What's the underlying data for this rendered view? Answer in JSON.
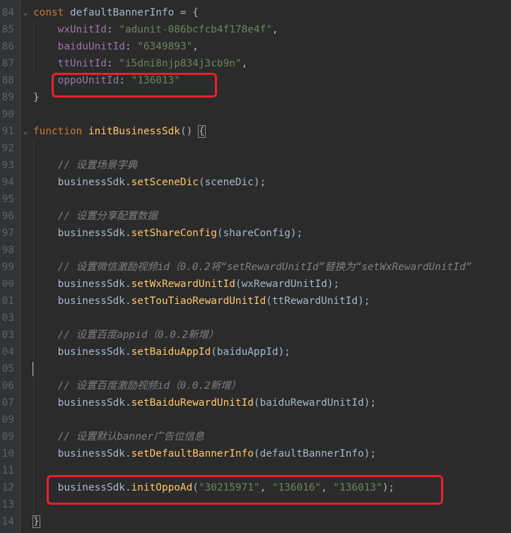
{
  "lines": [
    {
      "n": "84",
      "fold": "⌄",
      "tokens": [
        [
          "kw",
          "const "
        ],
        [
          "id",
          "defaultBannerInfo = {"
        ]
      ]
    },
    {
      "n": "85",
      "tokens": [
        [
          "id",
          "    "
        ],
        [
          "prop",
          "wxUnitId"
        ],
        [
          "id",
          ": "
        ],
        [
          "str",
          "\"adunit-086bcfcb4f178e4f\""
        ],
        [
          "id",
          ","
        ]
      ]
    },
    {
      "n": "86",
      "tokens": [
        [
          "id",
          "    "
        ],
        [
          "prop",
          "baiduUnitId"
        ],
        [
          "id",
          ": "
        ],
        [
          "str",
          "\"6349893\""
        ],
        [
          "id",
          ","
        ]
      ]
    },
    {
      "n": "87",
      "tokens": [
        [
          "id",
          "    "
        ],
        [
          "prop",
          "ttUnitId"
        ],
        [
          "id",
          ": "
        ],
        [
          "str",
          "\"i5dni8njp834j3cb9n\""
        ],
        [
          "id",
          ","
        ]
      ]
    },
    {
      "n": "88",
      "tokens": [
        [
          "id",
          "    "
        ],
        [
          "prop",
          "oppoUnitId"
        ],
        [
          "id",
          ": "
        ],
        [
          "str",
          "\"136013\""
        ]
      ]
    },
    {
      "n": "89",
      "tokens": [
        [
          "id",
          "}"
        ]
      ]
    },
    {
      "n": "90",
      "tokens": []
    },
    {
      "n": "91",
      "fold": "⌄",
      "tokens": [
        [
          "kw",
          "function "
        ],
        [
          "fn",
          "initBusinessSdk"
        ],
        [
          "id",
          "() "
        ],
        [
          "bracket",
          "{"
        ]
      ]
    },
    {
      "n": "92",
      "tokens": []
    },
    {
      "n": "93",
      "tokens": [
        [
          "id",
          "    "
        ],
        [
          "cm",
          "// 设置场景字典"
        ]
      ]
    },
    {
      "n": "94",
      "tokens": [
        [
          "id",
          "    businessSdk."
        ],
        [
          "fn",
          "setSceneDic"
        ],
        [
          "id",
          "(sceneDic);"
        ]
      ]
    },
    {
      "n": "95",
      "tokens": []
    },
    {
      "n": "96",
      "tokens": [
        [
          "id",
          "    "
        ],
        [
          "cm",
          "// 设置分享配置数据"
        ]
      ]
    },
    {
      "n": "97",
      "tokens": [
        [
          "id",
          "    businessSdk."
        ],
        [
          "fn",
          "setShareConfig"
        ],
        [
          "id",
          "(shareConfig);"
        ]
      ]
    },
    {
      "n": "98",
      "tokens": []
    },
    {
      "n": "99",
      "tokens": [
        [
          "id",
          "    "
        ],
        [
          "cm",
          "// 设置微信激励视频id（0.0.2将“setRewardUnitId”替换为“setWxRewardUnitId”"
        ]
      ]
    },
    {
      "n": "00",
      "tokens": [
        [
          "id",
          "    businessSdk."
        ],
        [
          "fn",
          "setWxRewardUnitId"
        ],
        [
          "id",
          "(wxRewardUnitId);"
        ]
      ]
    },
    {
      "n": "01",
      "tokens": [
        [
          "id",
          "    businessSdk."
        ],
        [
          "fn",
          "setTouTiaoRewardUnitId"
        ],
        [
          "id",
          "(ttRewardUnitId);"
        ]
      ]
    },
    {
      "n": "03",
      "tokens": []
    },
    {
      "n": "03",
      "tokens": [
        [
          "id",
          "    "
        ],
        [
          "cm",
          "// 设置百度appid（0.0.2新增）"
        ]
      ]
    },
    {
      "n": "04",
      "tokens": [
        [
          "id",
          "    businessSdk."
        ],
        [
          "fn",
          "setBaiduAppId"
        ],
        [
          "id",
          "(baiduAppId);"
        ]
      ]
    },
    {
      "n": "05",
      "caret": true,
      "tokens": []
    },
    {
      "n": "06",
      "tokens": [
        [
          "id",
          "    "
        ],
        [
          "cm",
          "// 设置百度激励视频id（0.0.2新增）"
        ]
      ]
    },
    {
      "n": "07",
      "tokens": [
        [
          "id",
          "    businessSdk."
        ],
        [
          "fn",
          "setBaiduRewardUnitId"
        ],
        [
          "id",
          "(baiduRewardUnitId);"
        ]
      ]
    },
    {
      "n": "09",
      "tokens": []
    },
    {
      "n": "09",
      "tokens": [
        [
          "id",
          "    "
        ],
        [
          "cm",
          "// 设置默认banner广告位信息"
        ]
      ]
    },
    {
      "n": "10",
      "tokens": [
        [
          "id",
          "    businessSdk."
        ],
        [
          "fn",
          "setDefaultBannerInfo"
        ],
        [
          "id",
          "(defaultBannerInfo);"
        ]
      ]
    },
    {
      "n": "11",
      "tokens": []
    },
    {
      "n": "12",
      "tokens": [
        [
          "id",
          "    businessSdk."
        ],
        [
          "fn",
          "initOppoAd"
        ],
        [
          "id",
          "("
        ],
        [
          "str",
          "\"30215971\""
        ],
        [
          "id",
          ", "
        ],
        [
          "str",
          "\"136016\""
        ],
        [
          "id",
          ", "
        ],
        [
          "str",
          "\"136013\""
        ],
        [
          "id",
          ");"
        ]
      ]
    },
    {
      "n": "13",
      "tokens": []
    },
    {
      "n": "14",
      "tokens": [
        [
          "bracket",
          "}"
        ]
      ]
    }
  ],
  "colors": {
    "background": "#2b2b2b",
    "keyword": "#cc7832",
    "function": "#ffc66d",
    "string": "#6a8759",
    "property": "#9876aa",
    "comment": "#808080",
    "highlight_box": "#e8212b"
  }
}
